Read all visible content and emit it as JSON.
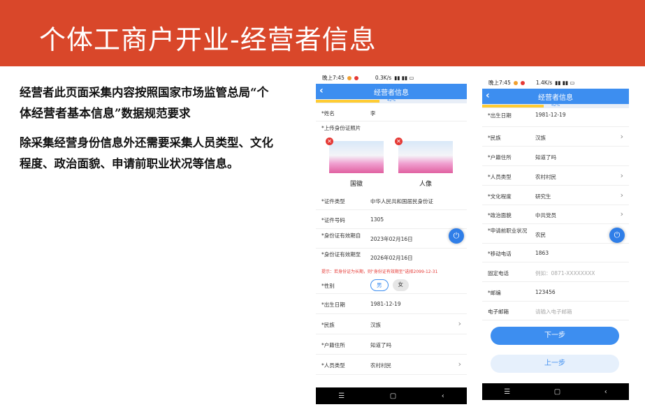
{
  "header": {
    "title": "个体工商户开业-经营者信息"
  },
  "text": {
    "para1_a": "经营者此页面采集内容按照国家市场监管总局“",
    "para1_b": "个体经营者基本信息",
    "para1_c": "”数据规范要求",
    "para2": "除采集经营身份信息外还需要采集人员类型、文化程度、政治面貌、申请前职业状况等信息。"
  },
  "phone1": {
    "status": {
      "time": "晚上7:45",
      "speed": "0.3K/s"
    },
    "appbar": {
      "title": "经营者信息",
      "back": "‹"
    },
    "progress": {
      "pct": "42%",
      "value": 0.42
    },
    "name": {
      "label": "*姓名",
      "value": "李"
    },
    "upload": {
      "label": "*上传身份证照片"
    },
    "id_front_caption": "国徽",
    "id_back_caption": "人像",
    "cert_type": {
      "label": "*证件类型",
      "value": "中华人民共和国居民身份证"
    },
    "cert_no": {
      "label": "*证件号码",
      "value": "1305"
    },
    "valid_from": {
      "label": "*身份证有效期自",
      "value": "2023年02月16日"
    },
    "valid_to": {
      "label": "*身份证有效期至",
      "value": "2026年02月16日"
    },
    "tip": "提示：若身份证为长期，则\"身份证有效期至\"选择2099-12-31",
    "gender": {
      "label": "*性别",
      "male": "男",
      "female": "女"
    },
    "birth": {
      "label": "*出生日期",
      "value": "1981-12-19"
    },
    "ethnic": {
      "label": "*民族",
      "value": "汉族"
    },
    "household": {
      "label": "*户籍住所",
      "value": "知道了吗"
    },
    "person_type": {
      "label": "*人员类型",
      "value": "农村村民"
    },
    "nav": {
      "menu": "☰",
      "home": "▢",
      "back": "‹"
    }
  },
  "phone2": {
    "status": {
      "time": "晚上7:45",
      "speed": "1.4K/s"
    },
    "appbar": {
      "title": "经营者信息",
      "back": "‹"
    },
    "progress": {
      "pct": "42%",
      "value": 0.42
    },
    "birth": {
      "label": "*出生日期",
      "value": "1981-12-19"
    },
    "ethnic": {
      "label": "*民族",
      "value": "汉族"
    },
    "household": {
      "label": "*户籍住所",
      "value": "知道了吗"
    },
    "person_type": {
      "label": "*人员类型",
      "value": "农村村民"
    },
    "education": {
      "label": "*文化程度",
      "value": "研究生"
    },
    "politics": {
      "label": "*政治面貌",
      "value": "中共党员"
    },
    "occupation": {
      "label": "*申请前职业状况",
      "value": "农民"
    },
    "mobile": {
      "label": "*移动电话",
      "value": "1863"
    },
    "phone": {
      "label": "固定电话",
      "placeholder": "例如：0871-XXXXXXXX"
    },
    "postcode": {
      "label": "*邮编",
      "value": "123456"
    },
    "email": {
      "label": "电子邮箱",
      "placeholder": "请输入电子邮箱"
    },
    "next_btn": "下一步",
    "prev_btn": "上一步",
    "nav": {
      "menu": "☰",
      "home": "▢",
      "back": "‹"
    }
  },
  "colors": {
    "header": "#d9472a",
    "primary": "#3d8ef0",
    "warning": "#e53935"
  }
}
